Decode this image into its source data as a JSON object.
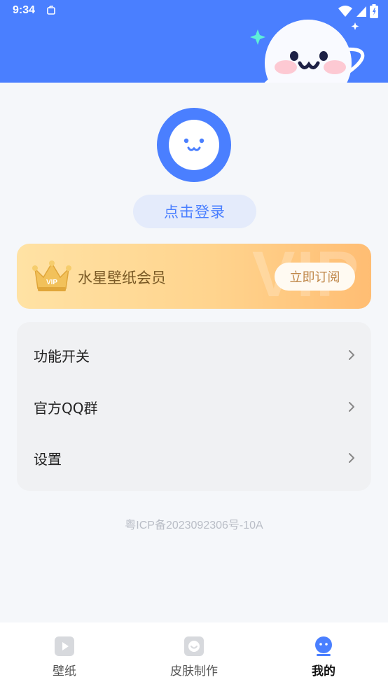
{
  "status_bar": {
    "time": "9:34",
    "icons": [
      "notification-icon",
      "wifi-icon",
      "signal-icon",
      "battery-icon"
    ]
  },
  "profile": {
    "login_label": "点击登录"
  },
  "vip": {
    "title": "水星壁纸会员",
    "watermark": "VIP",
    "crown_text": "VIP",
    "subscribe_label": "立即订阅"
  },
  "menu": {
    "items": [
      {
        "label": "功能开关",
        "icon": "chevron-right-icon"
      },
      {
        "label": "官方QQ群",
        "icon": "chevron-right-icon"
      },
      {
        "label": "设置",
        "icon": "chevron-right-icon"
      }
    ]
  },
  "footer": {
    "icp": "粤ICP备2023092306号-10A"
  },
  "bottom_nav": {
    "items": [
      {
        "label": "壁纸",
        "icon": "play-icon",
        "active": false
      },
      {
        "label": "皮肤制作",
        "icon": "skin-icon",
        "active": false
      },
      {
        "label": "我的",
        "icon": "profile-icon",
        "active": true
      }
    ]
  },
  "colors": {
    "brand": "#4a7fff",
    "vip_gold": "#ffd48e",
    "text_primary": "#222222",
    "text_muted": "#b9bdc6"
  }
}
